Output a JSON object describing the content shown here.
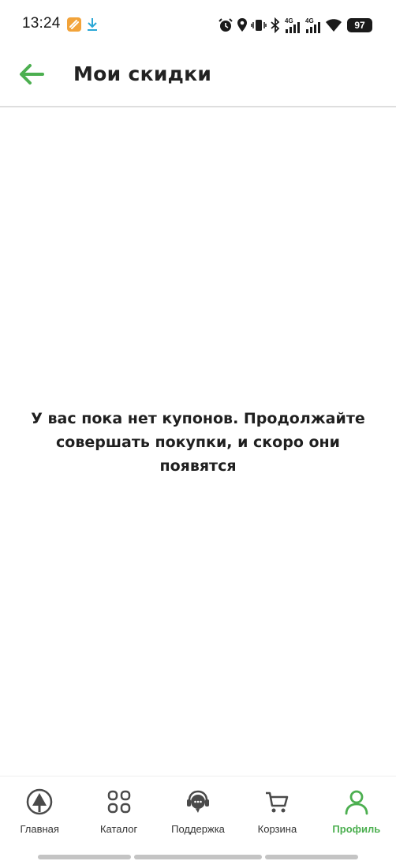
{
  "status_bar": {
    "time": "13:24",
    "battery": "97",
    "network_label_1": "4G",
    "network_label_2": "4G",
    "icons": [
      "app-badge-icon",
      "download-icon",
      "alarm-icon",
      "location-icon",
      "vibrate-icon",
      "bluetooth-icon",
      "signal-4g-icon",
      "signal-4g-icon",
      "wifi-icon",
      "battery-icon"
    ]
  },
  "header": {
    "title": "Мои скидки",
    "back_icon": "arrow-left-icon"
  },
  "main": {
    "empty_message": "У вас пока нет купонов. Продолжайте совершать покупки, и скоро они появятся"
  },
  "bottom_nav": {
    "items": [
      {
        "label": "Главная",
        "icon": "home-tree-icon",
        "active": false
      },
      {
        "label": "Каталог",
        "icon": "grid-icon",
        "active": false
      },
      {
        "label": "Поддержка",
        "icon": "headset-icon",
        "active": false
      },
      {
        "label": "Корзина",
        "icon": "cart-icon",
        "active": false
      },
      {
        "label": "Профиль",
        "icon": "person-icon",
        "active": true
      }
    ]
  },
  "colors": {
    "accent": "#4caf50",
    "text": "#1f1f1f",
    "icon": "#4a4a4a",
    "divider": "#dedede"
  }
}
